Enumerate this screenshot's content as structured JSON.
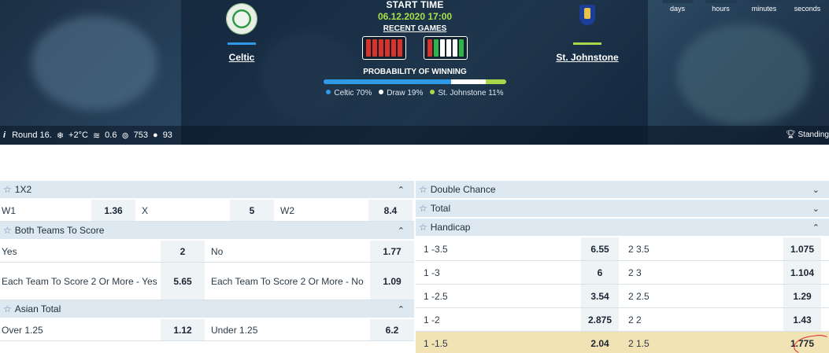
{
  "timer": {
    "labels": [
      "days",
      "hours",
      "minutes",
      "seconds"
    ]
  },
  "match": {
    "start_time_label": "START TIME",
    "start_datetime": "06.12.2020 17:00",
    "recent_games": "RECENT GAMES",
    "home": {
      "name": "Celtic",
      "bar_color": "#2f9be6"
    },
    "away": {
      "name": "St. Johnstone",
      "bar_color": "#a8d84a"
    },
    "home_form": [
      "#d9322a",
      "#d9322a",
      "#d9322a",
      "#d9322a",
      "#d9322a",
      "#d9322a"
    ],
    "away_form": [
      "#d9322a",
      "#2fb34a",
      "#ffffff",
      "#ffffff",
      "#ffffff",
      "#2fb34a"
    ],
    "probability_title": "PROBABILITY OF WINNING",
    "probabilities": [
      {
        "label": "Celtic 70%",
        "value": 0.7,
        "color": "#2f9be6"
      },
      {
        "label": "Draw 19%",
        "value": 0.19,
        "color": "#ffffff"
      },
      {
        "label": "St. Johnstone 11%",
        "value": 0.11,
        "color": "#a8d84a"
      }
    ]
  },
  "strip": {
    "info_icon": "info-icon",
    "round": "Round 16.",
    "temperature": "+2°C",
    "wind": "0.6",
    "pressure": "753",
    "humidity": "93",
    "standings": "Standing"
  },
  "left": {
    "m1x2": {
      "title": "1X2",
      "row": [
        {
          "label": "W1",
          "odd": "1.36"
        },
        {
          "label": "X",
          "odd": "5"
        },
        {
          "label": "W2",
          "odd": "8.4"
        }
      ]
    },
    "btts": {
      "title": "Both Teams To Score",
      "rows": [
        [
          {
            "label": "Yes",
            "odd": "2"
          },
          {
            "label": "No",
            "odd": "1.77"
          }
        ],
        [
          {
            "label": "Each Team To Score 2 Or More - Yes",
            "odd": "5.65"
          },
          {
            "label": "Each Team To Score 2 Or More - No",
            "odd": "1.09"
          }
        ]
      ]
    },
    "asian": {
      "title": "Asian Total",
      "row": [
        {
          "label": "Over 1.25",
          "odd": "1.12"
        },
        {
          "label": "Under 1.25",
          "odd": "6.2"
        }
      ]
    }
  },
  "right": {
    "double_chance": {
      "title": "Double Chance"
    },
    "total": {
      "title": "Total"
    },
    "handicap": {
      "title": "Handicap",
      "rows": [
        [
          {
            "label": "1 -3.5",
            "odd": "6.55"
          },
          {
            "label": "2 3.5",
            "odd": "1.075"
          }
        ],
        [
          {
            "label": "1 -3",
            "odd": "6"
          },
          {
            "label": "2 3",
            "odd": "1.104"
          }
        ],
        [
          {
            "label": "1 -2.5",
            "odd": "3.54"
          },
          {
            "label": "2 2.5",
            "odd": "1.29"
          }
        ],
        [
          {
            "label": "1 -2",
            "odd": "2.875"
          },
          {
            "label": "2 2",
            "odd": "1.43"
          }
        ],
        [
          {
            "label": "1 -1.5",
            "odd": "2.04"
          },
          {
            "label": "2 1.5",
            "odd": "1.775"
          }
        ]
      ]
    }
  }
}
